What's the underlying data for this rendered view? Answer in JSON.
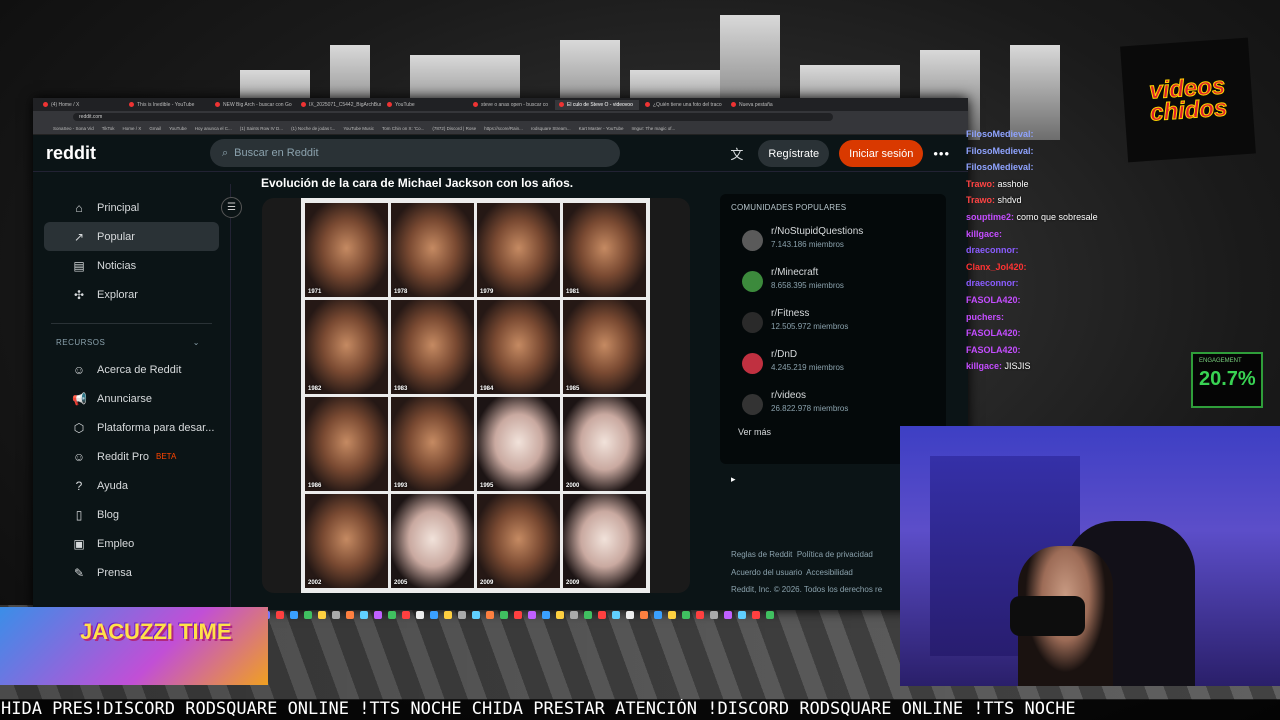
{
  "browser": {
    "tabs": [
      {
        "label": "(4) Home / X"
      },
      {
        "label": "This is Inedible - YouTube"
      },
      {
        "label": "NEW Big Arch - buscar con Go"
      },
      {
        "label": "IX_2025071_C5442_BigArchBur"
      },
      {
        "label": "YouTube"
      },
      {
        "label": "steve o anas open - buscar co"
      },
      {
        "label": "El culo de Steve O - videovoo"
      },
      {
        "label": "¿Quién tiene una foto del traco"
      },
      {
        "label": "Nueva pestaña"
      }
    ],
    "url": "reddit.com",
    "bookmarks": [
      "SonaSeo - Sona Vid",
      "TikTok",
      "Home / X",
      "Gmail",
      "YouTube",
      "Hoy anunca el C...",
      "(1) Saints Row IV D...",
      "(1) Noche de jodas t...",
      "YouTube Music",
      "Tom Chin on X: 'Co...",
      "(7872) Discord | Rose",
      "https://score/Rain...",
      "rodsquare Stream...",
      "Kart Master - YouTube",
      "Imgur: The magic of..."
    ]
  },
  "reddit": {
    "logo": "reddit",
    "search_placeholder": "Buscar en Reddit",
    "register": "Regístrate",
    "login": "Iniciar sesión",
    "nav": [
      {
        "label": "Principal",
        "icon": "home-icon",
        "glyph": "⌂"
      },
      {
        "label": "Popular",
        "icon": "popular-icon",
        "glyph": "↗"
      },
      {
        "label": "Noticias",
        "icon": "news-icon",
        "glyph": "▤"
      },
      {
        "label": "Explorar",
        "icon": "explore-icon",
        "glyph": "✣"
      }
    ],
    "resources_title": "RECURSOS",
    "resources": [
      {
        "label": "Acerca de Reddit",
        "icon": "reddit-alien-icon",
        "glyph": "☺"
      },
      {
        "label": "Anunciarse",
        "icon": "megaphone-icon",
        "glyph": "📢"
      },
      {
        "label": "Plataforma para desar...",
        "icon": "developer-platform-icon",
        "glyph": "⬡"
      },
      {
        "label": "Reddit Pro",
        "icon": "reddit-pro-icon",
        "glyph": "☺",
        "badge": "BETA"
      },
      {
        "label": "Ayuda",
        "icon": "help-icon",
        "glyph": "?"
      },
      {
        "label": "Blog",
        "icon": "blog-icon",
        "glyph": "▯"
      },
      {
        "label": "Empleo",
        "icon": "briefcase-icon",
        "glyph": "▣"
      },
      {
        "label": "Prensa",
        "icon": "press-icon",
        "glyph": "✎"
      }
    ],
    "post_title": "Evolución de la cara de Michael Jackson con los años.",
    "collage_years": [
      "1971",
      "1978",
      "1979",
      "1981",
      "1982",
      "1983",
      "1984",
      "1985",
      "1986",
      "1993",
      "1995",
      "2000",
      "2002",
      "2005",
      "2009",
      "2009"
    ],
    "communities_title": "COMUNIDADES POPULARES",
    "communities": [
      {
        "name": "r/NoStupidQuestions",
        "members": "7.143.186 miembros"
      },
      {
        "name": "r/Minecraft",
        "members": "8.658.395 miembros"
      },
      {
        "name": "r/Fitness",
        "members": "12.505.972 miembros"
      },
      {
        "name": "r/DnD",
        "members": "4.245.219 miembros"
      },
      {
        "name": "r/videos",
        "members": "26.822.978 miembros"
      }
    ],
    "see_more": "Ver más",
    "footer": {
      "rules": "Reglas de Reddit",
      "privacy": "Política de privacidad",
      "agreement": "Acuerdo del usuario",
      "accessibility": "Accesibilidad",
      "copyright": "Reddit, Inc. © 2026. Todos los derechos re"
    }
  },
  "stream": {
    "logo_line1": "videos",
    "logo_line2": "chidos",
    "chat": [
      {
        "user": "FilosoMedieval:",
        "msg": "",
        "color": "#8fa3ff"
      },
      {
        "user": "FilosoMedieval:",
        "msg": "",
        "color": "#8fa3ff"
      },
      {
        "user": "FilosoMedieval:",
        "msg": "",
        "color": "#8fa3ff"
      },
      {
        "user": "Trawo:",
        "msg": "asshole",
        "color": "#ff4444"
      },
      {
        "user": "Trawo:",
        "msg": "shdvd",
        "color": "#ff4444"
      },
      {
        "user": "souptime2:",
        "msg": "como que sobresale",
        "color": "#c44dff"
      },
      {
        "user": "killgace:",
        "msg": "",
        "color": "#c44dff"
      },
      {
        "user": "draeconnor:",
        "msg": "",
        "color": "#8a5cff"
      },
      {
        "user": "Clanx_Jol420:",
        "msg": "",
        "color": "#ff3333"
      },
      {
        "user": "draeconnor:",
        "msg": "",
        "color": "#8a5cff"
      },
      {
        "user": "FASOLA420:",
        "msg": "",
        "color": "#c44dff"
      },
      {
        "user": "puchers:",
        "msg": "",
        "color": "#c44dff"
      },
      {
        "user": "FASOLA420:",
        "msg": "",
        "color": "#c44dff"
      },
      {
        "user": "FASOLA420:",
        "msg": "",
        "color": "#c44dff"
      },
      {
        "user": "killgace:",
        "msg": "JISJIS",
        "color": "#c44dff"
      }
    ],
    "engagement_label": "ENGAGEMENT",
    "engagement_value": "20.7%",
    "jacuzzi": "JACUZZI TIME",
    "ticker": "HIDA PRES!DISCORD RODSQUARE ONLINE !TTS NOCHE CHIDA PRESTAR ATENCIÓN !DISCORD RODSQUARE ONLINE !TTS NOCHE"
  },
  "colors": {
    "reddit_bg": "#0b1416",
    "login_orange": "#d93900",
    "engagement_green": "#39d353"
  }
}
